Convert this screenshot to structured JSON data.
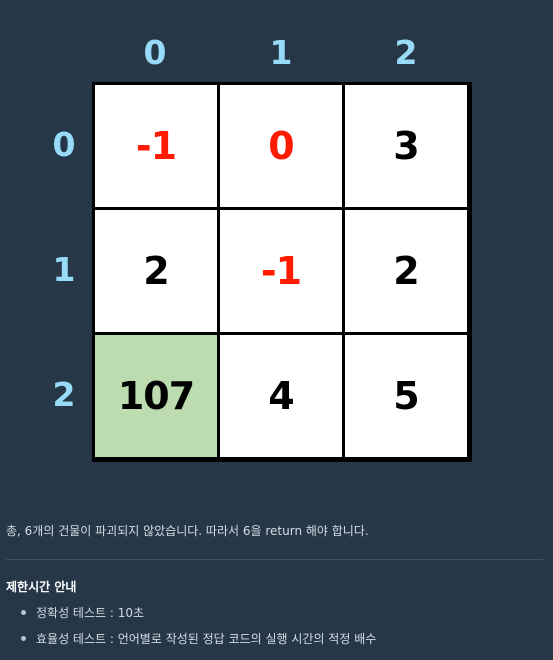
{
  "grid": {
    "col_headers": [
      "0",
      "1",
      "2"
    ],
    "row_headers": [
      "0",
      "1",
      "2"
    ],
    "rows": [
      [
        "-1",
        "0",
        "3"
      ],
      [
        "2",
        "-1",
        "2"
      ],
      [
        "107",
        "4",
        "5"
      ]
    ],
    "highlighted_cell": {
      "row": 2,
      "col": 0
    },
    "colors": {
      "header": "#98dbf8",
      "negative_value": "#ff1a00",
      "highlight": "#bcdcb0",
      "background": "#263747",
      "cell": "#ffffff"
    }
  },
  "caption": "총, 6개의 건물이 파괴되지 않았습니다. 따라서 6을 return 해야 합니다.",
  "limits": {
    "title": "제한시간 안내",
    "items": [
      "정확성 테스트 : 10초",
      "효율성 테스트 : 언어별로 작성된 정답 코드의 실행 시간의 적정 배수"
    ]
  }
}
